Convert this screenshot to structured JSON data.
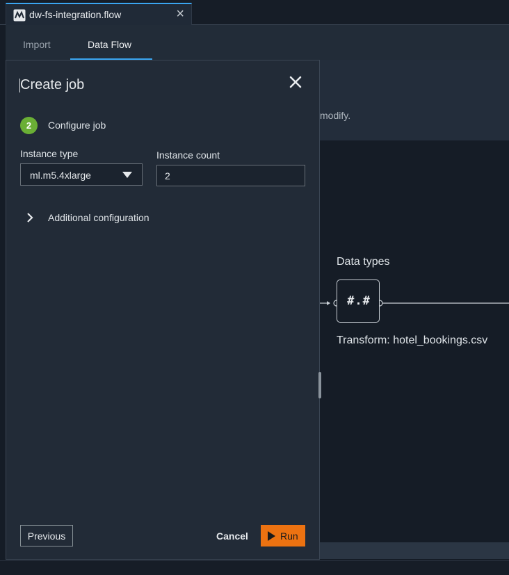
{
  "file_tab": {
    "title": "dw-fs-integration.flow",
    "logo_icon": "data-wrangler-logo-icon",
    "close_icon": "close-icon"
  },
  "view_tabs": [
    {
      "label": "Import",
      "active": false
    },
    {
      "label": "Data Flow",
      "active": true
    }
  ],
  "canvas": {
    "hint_text": "modify.",
    "node_title": "Data types",
    "node_symbol": "#.#",
    "node_caption": "Transform: hotel_bookings.csv"
  },
  "panel": {
    "title": "Create job",
    "step": {
      "number": "2",
      "label": "Configure job"
    },
    "instance_type": {
      "label": "Instance type",
      "value": "ml.m5.4xlarge"
    },
    "instance_count": {
      "label": "Instance count",
      "value": "2"
    },
    "additional_config": "Additional configuration",
    "buttons": {
      "previous": "Previous",
      "cancel": "Cancel",
      "run": "Run"
    }
  },
  "colors": {
    "accent_blue": "#3aa5f0",
    "run_orange": "#ec7211",
    "step_green": "#6aaf35",
    "panel_bg": "#222b37"
  }
}
